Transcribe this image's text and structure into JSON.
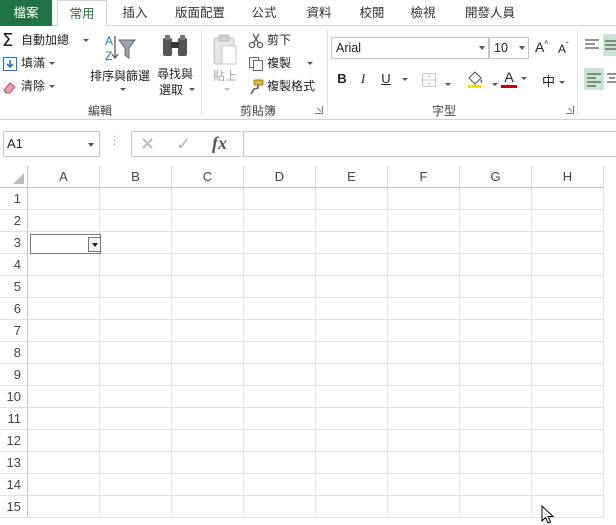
{
  "tabs": [
    {
      "label": "檔案"
    },
    {
      "label": "常用"
    },
    {
      "label": "插入"
    },
    {
      "label": "版面配置"
    },
    {
      "label": "公式"
    },
    {
      "label": "資料"
    },
    {
      "label": "校閱"
    },
    {
      "label": "檢視"
    },
    {
      "label": "開發人員"
    }
  ],
  "ribbon": {
    "editing": {
      "autosum": "自動加總",
      "fill": "填滿",
      "clear": "清除",
      "sort_filter": "排序與篩選",
      "find_select_1": "尋找與",
      "find_select_2": "選取",
      "group_label": "編輯"
    },
    "clipboard": {
      "paste": "貼上",
      "cut": "剪下",
      "copy": "複製",
      "format_painter": "複製格式",
      "group_label": "剪貼簿"
    },
    "font": {
      "name": "Arial",
      "size": "10",
      "bold": "B",
      "italic": "I",
      "underline": "U",
      "group_label": "字型"
    }
  },
  "formula_bar": {
    "name_box": "A1",
    "cancel_symbol": "✕",
    "enter_symbol": "✓",
    "fx_symbol": "fx",
    "value": ""
  },
  "sheet": {
    "columns": [
      "A",
      "B",
      "C",
      "D",
      "E",
      "F",
      "G",
      "H"
    ],
    "rows": [
      "1",
      "2",
      "3",
      "4",
      "5",
      "6",
      "7",
      "8",
      "9",
      "10",
      "11",
      "12",
      "13",
      "14",
      "15"
    ],
    "selected_cell": "A3"
  },
  "colors": {
    "accent": "#217346",
    "gridline": "#e2e2e2"
  }
}
